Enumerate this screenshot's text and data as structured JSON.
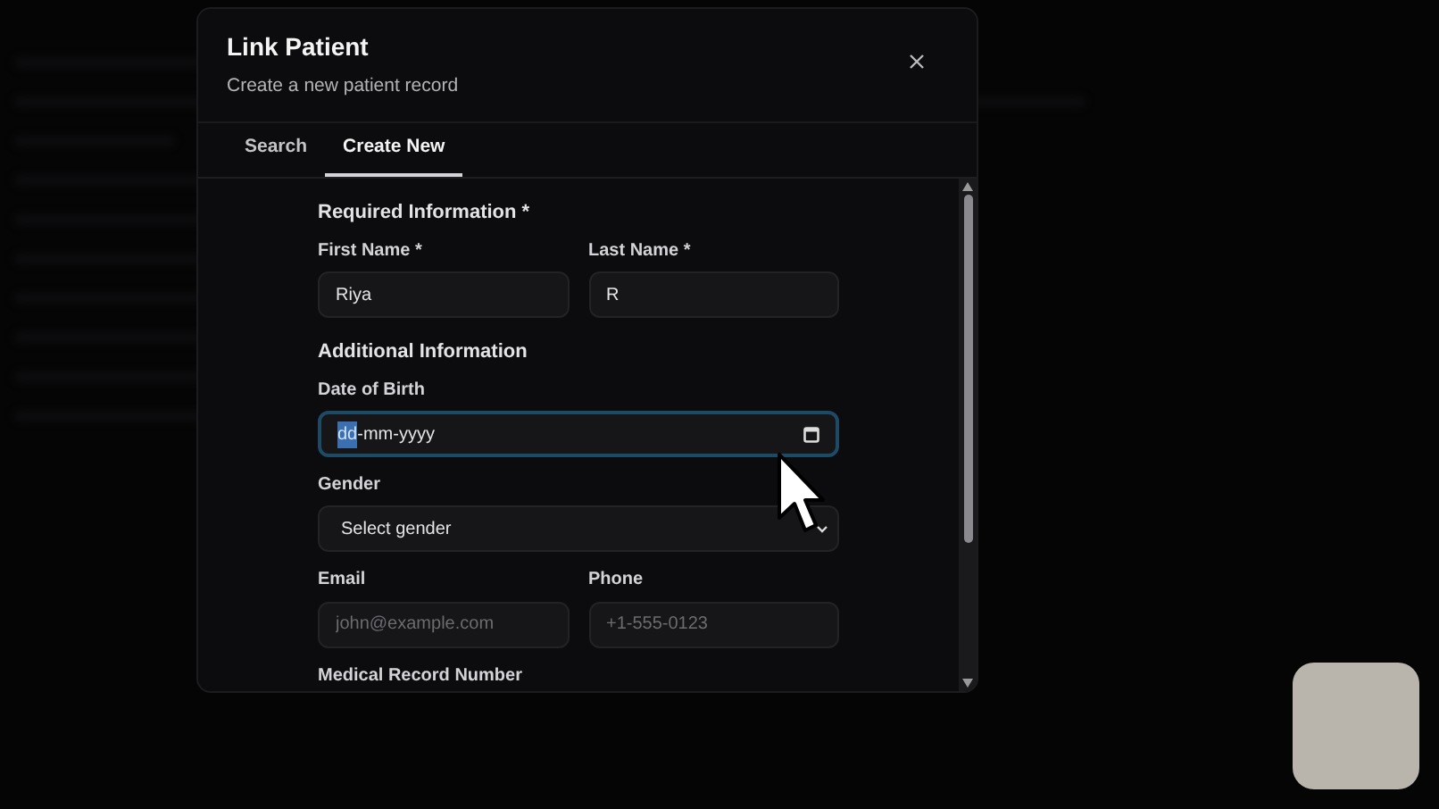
{
  "dialog": {
    "title": "Link Patient",
    "subtitle": "Create a new patient record",
    "tabs": [
      {
        "label": "Search",
        "selected": false
      },
      {
        "label": "Create New",
        "selected": true
      }
    ],
    "sections": [
      {
        "heading": "Required Information *",
        "rows": [
          [
            {
              "kind": "text",
              "label": "First Name *",
              "value": "Riya"
            },
            {
              "kind": "text",
              "label": "Last Name *",
              "value": "R"
            }
          ]
        ]
      },
      {
        "heading": "Additional Information",
        "rows": [
          [
            {
              "kind": "date",
              "label": "Date of Birth",
              "value": "-mm-yyyy",
              "selected_part": "dd",
              "focused": true
            }
          ],
          [
            {
              "kind": "select",
              "label": "Gender",
              "value": "Select gender"
            }
          ],
          [
            {
              "kind": "text",
              "label": "Email",
              "placeholder": "john@example.com"
            },
            {
              "kind": "text",
              "label": "Phone",
              "placeholder": "+1-555-0123"
            }
          ],
          [
            {
              "kind": "label",
              "label": "Medical Record Number"
            }
          ]
        ]
      }
    ]
  }
}
